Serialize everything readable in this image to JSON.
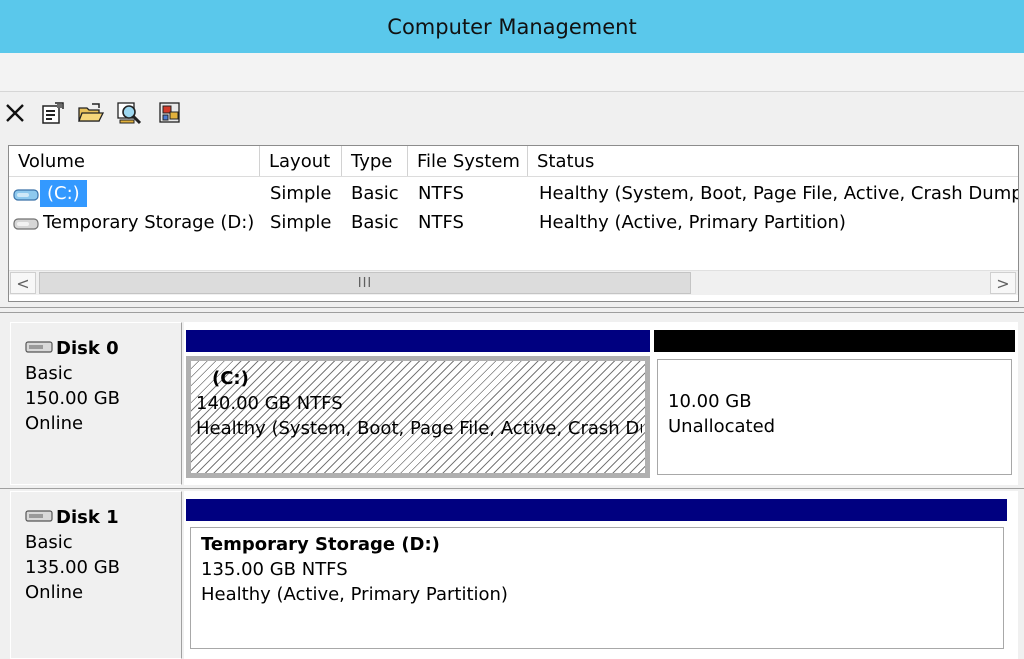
{
  "window": {
    "title": "Computer Management"
  },
  "toolbar": {
    "buttons": [
      {
        "icon": "delete-icon",
        "label": "Delete"
      },
      {
        "icon": "properties-icon",
        "label": "Properties"
      },
      {
        "icon": "open-folder-icon",
        "label": "Open"
      },
      {
        "icon": "explore-icon",
        "label": "Explore"
      },
      {
        "icon": "help-icon",
        "label": "Help"
      }
    ]
  },
  "volume_list": {
    "columns": [
      "Volume",
      "Layout",
      "Type",
      "File System",
      "Status"
    ],
    "rows": [
      {
        "volume": "(C:)",
        "layout": "Simple",
        "type": "Basic",
        "fs": "NTFS",
        "status": "Healthy (System, Boot, Page File, Active, Crash Dump,",
        "selected": true
      },
      {
        "volume": "Temporary Storage (D:)",
        "layout": "Simple",
        "type": "Basic",
        "fs": "NTFS",
        "status": "Healthy (Active, Primary Partition)",
        "selected": false
      }
    ],
    "scrollbar": {
      "left_arrow": "<",
      "right_arrow": ">",
      "thumb_grip": "III"
    }
  },
  "disks": [
    {
      "name": "Disk 0",
      "type": "Basic",
      "size": "150.00 GB",
      "state": "Online",
      "partitions": [
        {
          "title": "(C:)",
          "size_fs": "140.00 GB NTFS",
          "status": "Healthy (System, Boot, Page File, Active, Crash Dump)",
          "bar_color": "#000080",
          "selected": true
        },
        {
          "title": "",
          "size_fs": "10.00 GB",
          "status": "Unallocated",
          "bar_color": "#000000",
          "selected": false
        }
      ]
    },
    {
      "name": "Disk 1",
      "type": "Basic",
      "size": "135.00 GB",
      "state": "Online",
      "partitions": [
        {
          "title": "Temporary Storage  (D:)",
          "size_fs": "135.00 GB NTFS",
          "status": "Healthy (Active, Primary Partition)",
          "bar_color": "#000080",
          "selected": false
        }
      ]
    }
  ],
  "colors": {
    "titlebar": "#5ac8eb",
    "primary_partition": "#000080",
    "unallocated": "#000000",
    "selection": "#3399ff"
  }
}
